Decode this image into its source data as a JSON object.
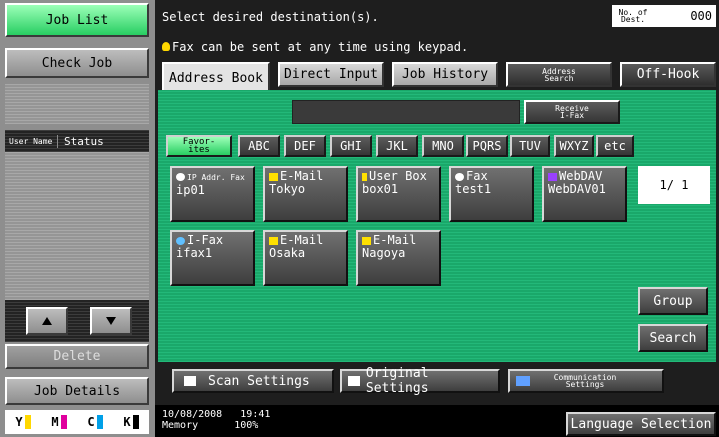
{
  "left": {
    "job_list": "Job List",
    "check_job": "Check Job",
    "user_name": "User Name",
    "status": "Status",
    "delete": "Delete",
    "job_details": "Job Details",
    "toner": [
      {
        "label": "Y",
        "color": "#ffd800"
      },
      {
        "label": "M",
        "color": "#e0009e"
      },
      {
        "label": "C",
        "color": "#00a0e8"
      },
      {
        "label": "K",
        "color": "#000000"
      }
    ]
  },
  "header": {
    "message": "Select desired destination(s).",
    "hint": "Fax can be sent at any time using keypad.",
    "dest_count_label": "No. of Dest.",
    "dest_count": "000"
  },
  "tabs": {
    "address_book": "Address Book",
    "direct_input": "Direct Input",
    "job_history": "Job History",
    "address_search": "Address Search",
    "off_hook": "Off-Hook"
  },
  "receive_ifax": "Receive I-Fax",
  "index": [
    "Favor-ites",
    "ABC",
    "DEF",
    "GHI",
    "JKL",
    "MNO",
    "PQRS",
    "TUV",
    "WXYZ",
    "etc"
  ],
  "destinations": [
    {
      "type": "IP Addr. Fax",
      "name": "ip01",
      "icon_color": "#ffffff"
    },
    {
      "type": "E-Mail",
      "name": "Tokyo",
      "icon_color": "#ffe000"
    },
    {
      "type": "User Box",
      "name": "box01",
      "icon_color": "#ffe000"
    },
    {
      "type": "Fax",
      "name": "test1",
      "icon_color": "#ffffff"
    },
    {
      "type": "WebDAV",
      "name": "WebDAV01",
      "icon_color": "#9a40ff"
    },
    {
      "type": "I-Fax",
      "name": "ifax1",
      "icon_color": "#60c0ff"
    },
    {
      "type": "E-Mail",
      "name": "Osaka",
      "icon_color": "#ffe000"
    },
    {
      "type": "E-Mail",
      "name": "Nagoya",
      "icon_color": "#ffe000"
    }
  ],
  "page_indicator": "1/ 1",
  "group": "Group",
  "search": "Search",
  "bottom": {
    "scan_settings": "Scan Settings",
    "original_settings": "Original Settings",
    "communication_settings": "Communication Settings"
  },
  "footer": {
    "date": "10/08/2008",
    "time": "19:41",
    "memory_label": "Memory",
    "memory_value": "100%",
    "language_selection": "Language Selection"
  }
}
